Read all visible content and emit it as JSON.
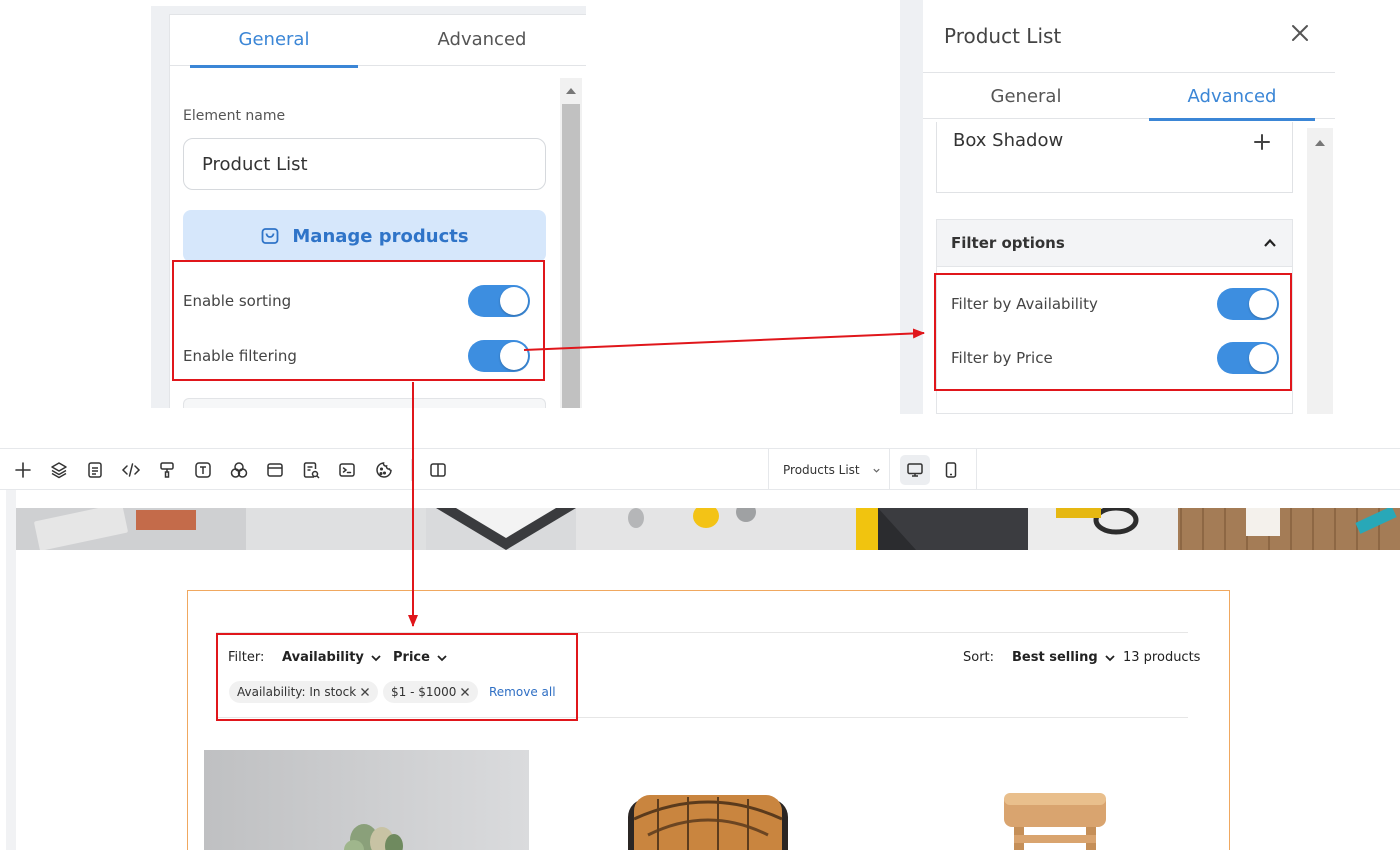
{
  "left_panel": {
    "tabs": [
      "General",
      "Advanced"
    ],
    "active_tab": "General",
    "element_name_label": "Element name",
    "element_name_value": "Product List",
    "manage_button_label": "Manage products",
    "toggles": [
      {
        "label": "Enable sorting",
        "on": true
      },
      {
        "label": "Enable filtering",
        "on": true
      }
    ]
  },
  "right_panel": {
    "title": "Product List",
    "tabs": [
      "General",
      "Advanced"
    ],
    "active_tab": "Advanced",
    "box_shadow_label": "Box Shadow",
    "filter_section_title": "Filter options",
    "toggles": [
      {
        "label": "Filter by Availability",
        "on": true
      },
      {
        "label": "Filter by Price",
        "on": true
      }
    ]
  },
  "toolbar": {
    "tools": [
      "add-icon",
      "layers-icon",
      "page-icon",
      "code-icon",
      "paint-roller-icon",
      "text-icon",
      "shapes-icon",
      "section-icon",
      "form-search-icon",
      "terminal-icon",
      "cookie-icon",
      "split-view-icon"
    ],
    "page_select_label": "Products List",
    "devices": [
      "desktop-icon",
      "mobile-icon"
    ]
  },
  "storefront": {
    "filter_label": "Filter:",
    "filter_dropdowns": [
      "Availability",
      "Price"
    ],
    "sort_label": "Sort:",
    "sort_value": "Best selling",
    "product_count": "13 products",
    "chips": [
      "Availability: In stock",
      "$1 - $1000"
    ],
    "remove_all_label": "Remove all"
  },
  "colors": {
    "accent": "#3b86d6",
    "toggle_on": "#3d8ee0",
    "highlight": "#e0161b",
    "product_frame": "#f0a860",
    "manage_button_bg": "#d6e7fb"
  }
}
